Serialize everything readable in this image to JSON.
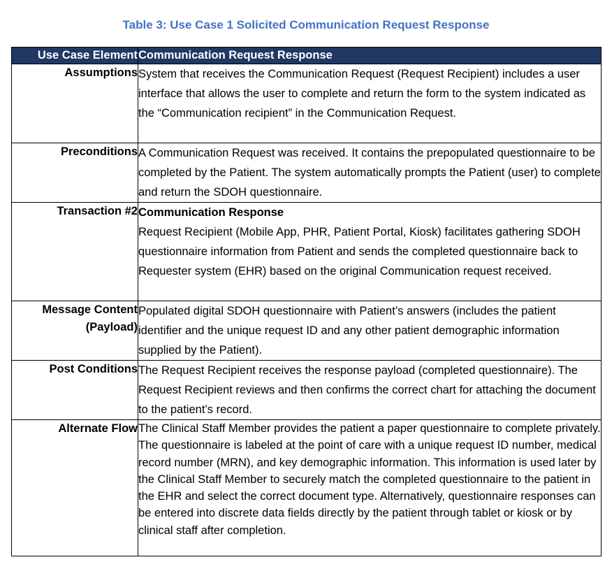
{
  "caption": "Table 3: Use Case 1 Solicited Communication Request Response",
  "header": {
    "col1": "Use Case Element",
    "col2": "Communication Request Response"
  },
  "rows": [
    {
      "element": "Assumptions",
      "text": "System that receives the Communication Request (Request Recipient) includes a user interface that allows the user to complete and return the form to the system indicated as the “Communication recipient” in the Communication Request."
    },
    {
      "element": "Preconditions",
      "text": "A Communication Request was received.  It contains the prepopulated questionnaire to be completed by the Patient.  The system automatically prompts the Patient (user) to complete and return the SDOH questionnaire."
    },
    {
      "element": "Transaction #2",
      "subtitle": "Communication Response",
      "text": "Request Recipient (Mobile App, PHR, Patient Portal, Kiosk) facilitates gathering SDOH questionnaire information from Patient and sends the completed questionnaire back to Requester system (EHR) based on the original Communication request received."
    },
    {
      "element": "Message Content\n(Payload)",
      "text": "Populated digital SDOH questionnaire with Patient’s answers (includes the patient identifier and the unique request ID and any other patient demographic information supplied by the Patient)."
    },
    {
      "element": "Post Conditions",
      "text": "The Request Recipient receives the response payload (completed questionnaire).  The Request Recipient reviews and then confirms the correct chart for attaching the document to the patient’s record."
    },
    {
      "element": "Alternate Flow",
      "text": "The Clinical Staff Member provides the patient a paper questionnaire to complete privately.  The questionnaire is labeled at the point of care with a unique request ID number, medical record number (MRN),  and key demographic information.  This information is used later by the Clinical Staff Member to securely match the completed questionnaire to the patient in the EHR and select the correct document type.  Alternatively, questionnaire responses can be entered into discrete data fields directly by the patient through tablet or kiosk or by clinical staff after completion."
    }
  ]
}
